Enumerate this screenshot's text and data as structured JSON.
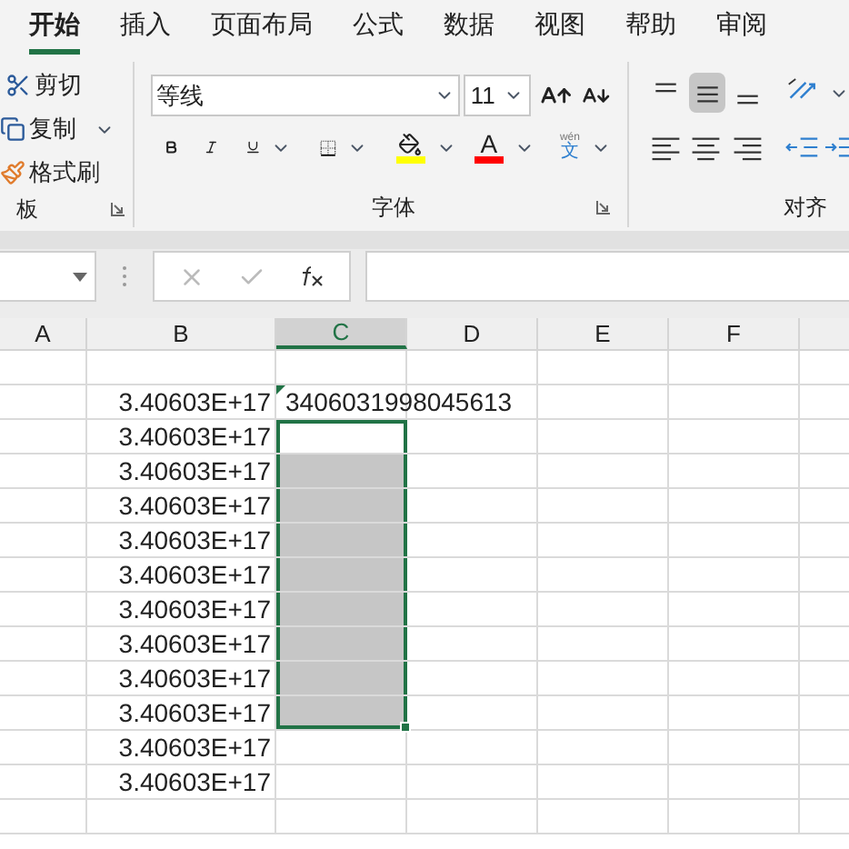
{
  "tabs": [
    {
      "label": "开始",
      "selected": true
    },
    {
      "label": "插入",
      "selected": false
    },
    {
      "label": "页面布局",
      "selected": false
    },
    {
      "label": "公式",
      "selected": false
    },
    {
      "label": "数据",
      "selected": false
    },
    {
      "label": "视图",
      "selected": false
    },
    {
      "label": "帮助",
      "selected": false
    },
    {
      "label": "审阅",
      "selected": false
    }
  ],
  "clipboard": {
    "items": [
      {
        "kind": "cut",
        "label": "剪切"
      },
      {
        "kind": "copy",
        "label": "复制"
      },
      {
        "kind": "painter",
        "label": "格式刷"
      }
    ],
    "label": "板"
  },
  "font": {
    "name": "等线",
    "size": "11",
    "font_color_letter": "A",
    "phonetic_top": "wén",
    "phonetic_bottom": "文",
    "label": "字体"
  },
  "alignment": {
    "label": "对齐",
    "middle_selected": true
  },
  "columns": [
    {
      "label": "A",
      "selected": false
    },
    {
      "label": "B",
      "selected": false
    },
    {
      "label": "C",
      "selected": true
    },
    {
      "label": "D",
      "selected": false
    },
    {
      "label": "E",
      "selected": false
    },
    {
      "label": "F",
      "selected": false
    }
  ],
  "rows": [
    {
      "selected": false,
      "active": false
    },
    {
      "b": "3.40603E+17",
      "c": "3406031998045613",
      "error_flag": true,
      "selected": false,
      "active": false
    },
    {
      "b": "3.40603E+17",
      "selected": true,
      "active": true
    },
    {
      "b": "3.40603E+17",
      "selected": true,
      "active": false
    },
    {
      "b": "3.40603E+17",
      "selected": true,
      "active": false
    },
    {
      "b": "3.40603E+17",
      "selected": true,
      "active": false
    },
    {
      "b": "3.40603E+17",
      "selected": true,
      "active": false
    },
    {
      "b": "3.40603E+17",
      "selected": true,
      "active": false
    },
    {
      "b": "3.40603E+17",
      "selected": true,
      "active": false
    },
    {
      "b": "3.40603E+17",
      "selected": true,
      "active": false
    },
    {
      "b": "3.40603E+17",
      "selected": true,
      "active": false
    },
    {
      "b": "3.40603E+17",
      "selected": false,
      "active": false
    },
    {
      "b": "3.40603E+17",
      "selected": false,
      "active": false
    },
    {
      "selected": false,
      "active": false
    }
  ]
}
